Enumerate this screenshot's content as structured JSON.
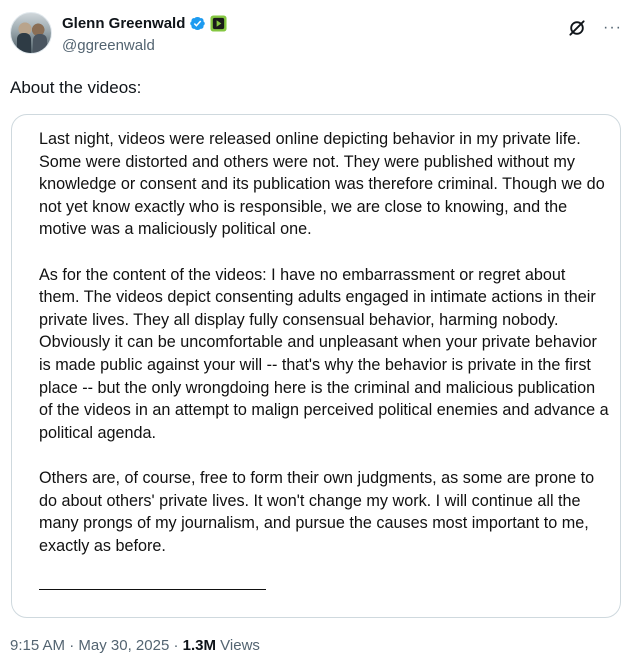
{
  "author": {
    "name": "Glenn Greenwald",
    "handle": "@ggreenwald",
    "verified_color": "#1d9bf0",
    "avatar_icon": "avatar",
    "badge_icon": "rumble-badge-icon"
  },
  "actions": {
    "grok_icon": "grok-icon",
    "more_label": "···"
  },
  "tweet": {
    "text": "About the videos:"
  },
  "statement": {
    "paragraphs": [
      "Last night, videos were released online depicting behavior in my private life. Some were distorted and others were not. They were published without my knowledge or consent and its publication was therefore criminal. Though we do not yet know exactly who is responsible, we are close to knowing, and the motive was a maliciously political one.",
      "As for the content of the videos: I have no embarrassment or regret about them. The videos depict consenting adults engaged in intimate actions in their private lives. They all display fully consensual behavior, harming nobody. Obviously it can be uncomfortable and unpleasant when your private behavior is made public against your will -- that's why the behavior is private in the first place -- but the only wrongdoing here is the criminal and malicious publication of the videos in an attempt to malign perceived political enemies and advance a political agenda.",
      "Others are, of course, free to form their own judgments, as some are prone to do about others' private lives. It won't change my work. I will continue all the many prongs of my journalism, and pursue the causes most important to me, exactly as before."
    ]
  },
  "meta": {
    "time": "9:15 AM",
    "separator1": " · ",
    "date": "May 30, 2025",
    "separator2": " · ",
    "views_count": "1.3M",
    "views_label": " Views"
  }
}
